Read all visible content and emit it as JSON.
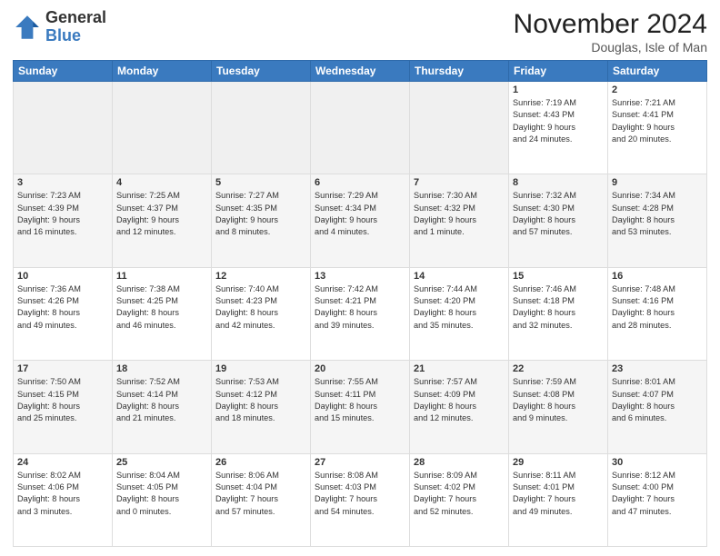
{
  "logo": {
    "general": "General",
    "blue": "Blue"
  },
  "header": {
    "month": "November 2024",
    "location": "Douglas, Isle of Man"
  },
  "weekdays": [
    "Sunday",
    "Monday",
    "Tuesday",
    "Wednesday",
    "Thursday",
    "Friday",
    "Saturday"
  ],
  "weeks": [
    [
      {
        "day": "",
        "info": ""
      },
      {
        "day": "",
        "info": ""
      },
      {
        "day": "",
        "info": ""
      },
      {
        "day": "",
        "info": ""
      },
      {
        "day": "",
        "info": ""
      },
      {
        "day": "1",
        "info": "Sunrise: 7:19 AM\nSunset: 4:43 PM\nDaylight: 9 hours\nand 24 minutes."
      },
      {
        "day": "2",
        "info": "Sunrise: 7:21 AM\nSunset: 4:41 PM\nDaylight: 9 hours\nand 20 minutes."
      }
    ],
    [
      {
        "day": "3",
        "info": "Sunrise: 7:23 AM\nSunset: 4:39 PM\nDaylight: 9 hours\nand 16 minutes."
      },
      {
        "day": "4",
        "info": "Sunrise: 7:25 AM\nSunset: 4:37 PM\nDaylight: 9 hours\nand 12 minutes."
      },
      {
        "day": "5",
        "info": "Sunrise: 7:27 AM\nSunset: 4:35 PM\nDaylight: 9 hours\nand 8 minutes."
      },
      {
        "day": "6",
        "info": "Sunrise: 7:29 AM\nSunset: 4:34 PM\nDaylight: 9 hours\nand 4 minutes."
      },
      {
        "day": "7",
        "info": "Sunrise: 7:30 AM\nSunset: 4:32 PM\nDaylight: 9 hours\nand 1 minute."
      },
      {
        "day": "8",
        "info": "Sunrise: 7:32 AM\nSunset: 4:30 PM\nDaylight: 8 hours\nand 57 minutes."
      },
      {
        "day": "9",
        "info": "Sunrise: 7:34 AM\nSunset: 4:28 PM\nDaylight: 8 hours\nand 53 minutes."
      }
    ],
    [
      {
        "day": "10",
        "info": "Sunrise: 7:36 AM\nSunset: 4:26 PM\nDaylight: 8 hours\nand 49 minutes."
      },
      {
        "day": "11",
        "info": "Sunrise: 7:38 AM\nSunset: 4:25 PM\nDaylight: 8 hours\nand 46 minutes."
      },
      {
        "day": "12",
        "info": "Sunrise: 7:40 AM\nSunset: 4:23 PM\nDaylight: 8 hours\nand 42 minutes."
      },
      {
        "day": "13",
        "info": "Sunrise: 7:42 AM\nSunset: 4:21 PM\nDaylight: 8 hours\nand 39 minutes."
      },
      {
        "day": "14",
        "info": "Sunrise: 7:44 AM\nSunset: 4:20 PM\nDaylight: 8 hours\nand 35 minutes."
      },
      {
        "day": "15",
        "info": "Sunrise: 7:46 AM\nSunset: 4:18 PM\nDaylight: 8 hours\nand 32 minutes."
      },
      {
        "day": "16",
        "info": "Sunrise: 7:48 AM\nSunset: 4:16 PM\nDaylight: 8 hours\nand 28 minutes."
      }
    ],
    [
      {
        "day": "17",
        "info": "Sunrise: 7:50 AM\nSunset: 4:15 PM\nDaylight: 8 hours\nand 25 minutes."
      },
      {
        "day": "18",
        "info": "Sunrise: 7:52 AM\nSunset: 4:14 PM\nDaylight: 8 hours\nand 21 minutes."
      },
      {
        "day": "19",
        "info": "Sunrise: 7:53 AM\nSunset: 4:12 PM\nDaylight: 8 hours\nand 18 minutes."
      },
      {
        "day": "20",
        "info": "Sunrise: 7:55 AM\nSunset: 4:11 PM\nDaylight: 8 hours\nand 15 minutes."
      },
      {
        "day": "21",
        "info": "Sunrise: 7:57 AM\nSunset: 4:09 PM\nDaylight: 8 hours\nand 12 minutes."
      },
      {
        "day": "22",
        "info": "Sunrise: 7:59 AM\nSunset: 4:08 PM\nDaylight: 8 hours\nand 9 minutes."
      },
      {
        "day": "23",
        "info": "Sunrise: 8:01 AM\nSunset: 4:07 PM\nDaylight: 8 hours\nand 6 minutes."
      }
    ],
    [
      {
        "day": "24",
        "info": "Sunrise: 8:02 AM\nSunset: 4:06 PM\nDaylight: 8 hours\nand 3 minutes."
      },
      {
        "day": "25",
        "info": "Sunrise: 8:04 AM\nSunset: 4:05 PM\nDaylight: 8 hours\nand 0 minutes."
      },
      {
        "day": "26",
        "info": "Sunrise: 8:06 AM\nSunset: 4:04 PM\nDaylight: 7 hours\nand 57 minutes."
      },
      {
        "day": "27",
        "info": "Sunrise: 8:08 AM\nSunset: 4:03 PM\nDaylight: 7 hours\nand 54 minutes."
      },
      {
        "day": "28",
        "info": "Sunrise: 8:09 AM\nSunset: 4:02 PM\nDaylight: 7 hours\nand 52 minutes."
      },
      {
        "day": "29",
        "info": "Sunrise: 8:11 AM\nSunset: 4:01 PM\nDaylight: 7 hours\nand 49 minutes."
      },
      {
        "day": "30",
        "info": "Sunrise: 8:12 AM\nSunset: 4:00 PM\nDaylight: 7 hours\nand 47 minutes."
      }
    ]
  ]
}
